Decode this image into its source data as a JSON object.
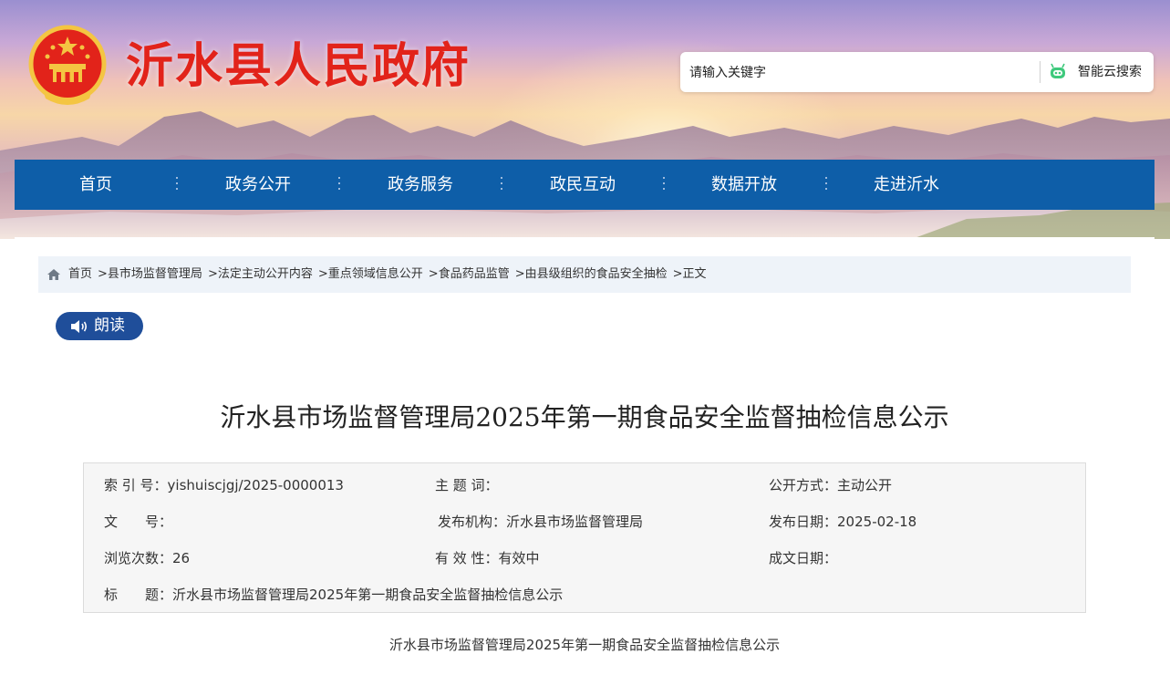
{
  "site": {
    "title": "沂水县人民政府",
    "emblem_icon": "national-emblem-icon"
  },
  "search": {
    "placeholder": "请输入关键字",
    "button_label": "智能云搜索",
    "button_icon": "robot-icon"
  },
  "nav": {
    "items": [
      {
        "label": "首页"
      },
      {
        "label": "政务公开"
      },
      {
        "label": "政务服务"
      },
      {
        "label": "政民互动"
      },
      {
        "label": "数据开放"
      },
      {
        "label": "走进沂水"
      }
    ]
  },
  "breadcrumb": {
    "home_icon": "home-icon",
    "separator": ">",
    "items": [
      "首页",
      "县市场监督管理局",
      "法定主动公开内容",
      "重点领域信息公开",
      "食品药品监管",
      "由县级组织的食品安全抽检",
      "正文"
    ]
  },
  "read_button": {
    "label": "朗读",
    "icon": "speaker-icon"
  },
  "article": {
    "title": "沂水县市场监督管理局2025年第一期食品安全监督抽检信息公示",
    "subtitle": "沂水县市场监督管理局2025年第一期食品安全监督抽检信息公示"
  },
  "meta": {
    "index_label": "索 引 号：",
    "index_value": "yishuiscjgj/2025-0000013",
    "keyword_label": "主 题 词：",
    "keyword_value": "",
    "public_label": "公开方式：",
    "public_value": "主动公开",
    "docno_label": "文　　号：",
    "docno_value": "",
    "org_label": "发布机构：",
    "org_value": "沂水县市场监督管理局",
    "date_label": "发布日期：",
    "date_value": "2025-02-18",
    "views_label": "浏览次数：",
    "views_value": "26",
    "valid_label": "有 效 性：",
    "valid_value": "有效中",
    "written_label": "成文日期：",
    "written_value": "",
    "title_label": "标　　题：",
    "title_value": "沂水县市场监督管理局2025年第一期食品安全监督抽检信息公示"
  },
  "colors": {
    "nav_bg": "#0e5ea8",
    "title_red": "#e2231a",
    "read_btn_bg": "#1f4e9a",
    "breadcrumb_bg": "#eef3f9"
  }
}
